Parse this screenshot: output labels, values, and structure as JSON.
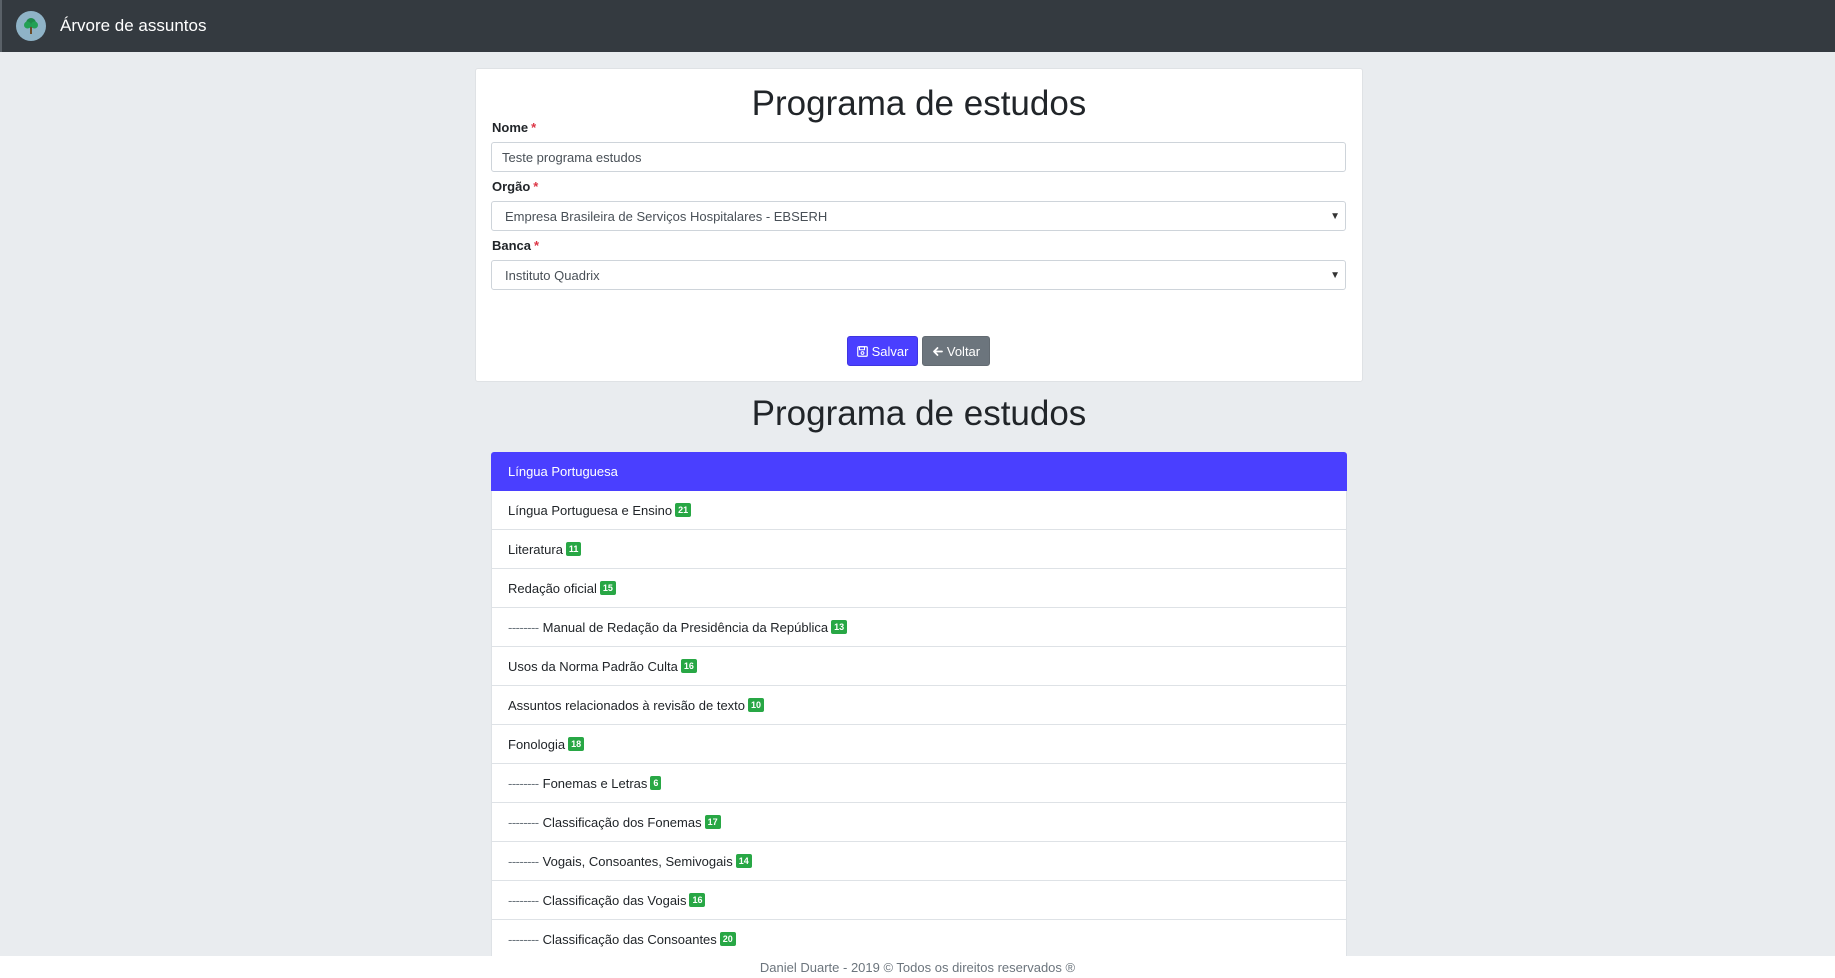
{
  "navbar": {
    "brand": "Árvore de assuntos",
    "logo_icon": "tree-icon"
  },
  "form": {
    "title": "Programa de estudos",
    "nome": {
      "label": "Nome",
      "required_mark": "*",
      "value": "Teste programa estudos"
    },
    "orgao": {
      "label": "Orgão",
      "required_mark": "*",
      "value": "Empresa Brasileira de Serviços Hospitalares - EBSERH"
    },
    "banca": {
      "label": "Banca",
      "required_mark": "*",
      "value": "Instituto Quadrix"
    },
    "save_label": "Salvar",
    "back_label": "Voltar"
  },
  "program": {
    "title": "Programa de estudos",
    "items": [
      {
        "prefix": "",
        "label": "Língua Portuguesa",
        "count": "",
        "active": true
      },
      {
        "prefix": "",
        "label": "Língua Portuguesa e Ensino",
        "count": "21",
        "active": false
      },
      {
        "prefix": "",
        "label": "Literatura",
        "count": "11",
        "active": false
      },
      {
        "prefix": "",
        "label": "Redação oficial",
        "count": "15",
        "active": false
      },
      {
        "prefix": "--------",
        "label": "Manual de Redação da Presidência da República",
        "count": "13",
        "active": false
      },
      {
        "prefix": "",
        "label": "Usos da Norma Padrão Culta",
        "count": "16",
        "active": false
      },
      {
        "prefix": "",
        "label": "Assuntos relacionados à revisão de texto",
        "count": "10",
        "active": false
      },
      {
        "prefix": "",
        "label": "Fonologia",
        "count": "18",
        "active": false
      },
      {
        "prefix": "--------",
        "label": "Fonemas e Letras",
        "count": "6",
        "active": false
      },
      {
        "prefix": "--------",
        "label": "Classificação dos Fonemas",
        "count": "17",
        "active": false
      },
      {
        "prefix": "--------",
        "label": "Vogais, Consoantes, Semivogais",
        "count": "14",
        "active": false
      },
      {
        "prefix": "--------",
        "label": "Classificação das Vogais",
        "count": "16",
        "active": false
      },
      {
        "prefix": "--------",
        "label": "Classificação das Consoantes",
        "count": "20",
        "active": false
      }
    ]
  },
  "footer": {
    "text": "Daniel Duarte - 2019 © Todos os direitos reservados ®"
  },
  "colors": {
    "primary": "#4a3fff",
    "navbar": "#343a40",
    "badge": "#28a745",
    "secondary": "#6c757d"
  }
}
